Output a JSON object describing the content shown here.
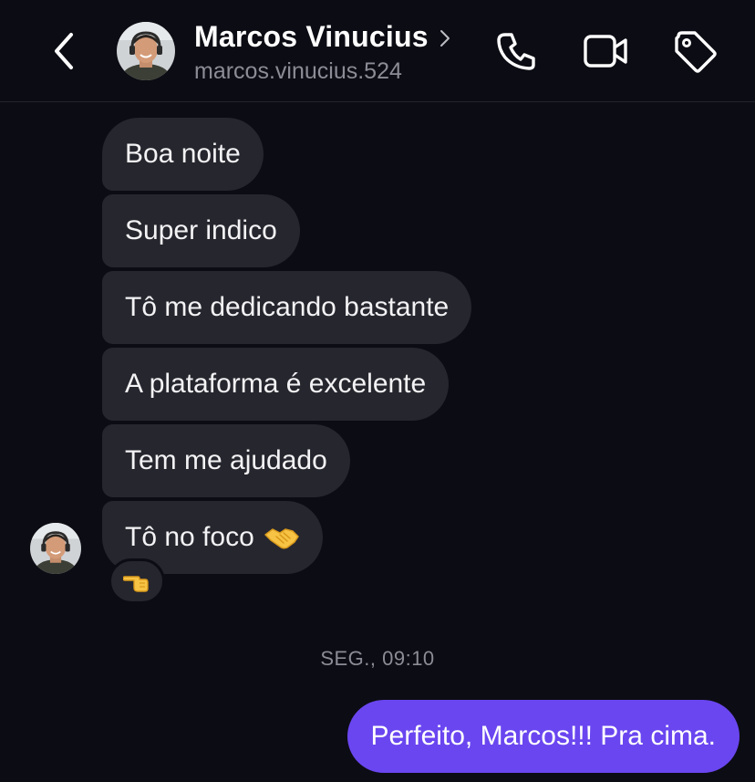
{
  "header": {
    "name": "Marcos Vinucius",
    "username": "marcos.vinucius.524",
    "icons": {
      "back": "chevron-left-icon",
      "profile_chevron": "chevron-right-icon",
      "call": "phone-icon",
      "video": "video-camera-icon",
      "tag": "tag-icon"
    }
  },
  "messages": [
    {
      "text": "Boa noite",
      "sender": "contact"
    },
    {
      "text": "Super indico",
      "sender": "contact"
    },
    {
      "text": "Tô me dedicando bastante",
      "sender": "contact"
    },
    {
      "text": "A plataforma é excelente",
      "sender": "contact"
    },
    {
      "text": "Tem me ajudado",
      "sender": "contact"
    },
    {
      "text": "Tô no foco",
      "sender": "contact",
      "emoji": "handshake-emoji",
      "reaction": "pointing-hand-emoji"
    }
  ],
  "timestamp": "SEG., 09:10",
  "outgoing": {
    "text": "Perfeito, Marcos!!! Pra cima."
  },
  "colors": {
    "background": "#0c0c14",
    "incoming_bubble": "#26262e",
    "outgoing_bubble": "#6a46f0",
    "secondary_text": "#8c8c96"
  }
}
